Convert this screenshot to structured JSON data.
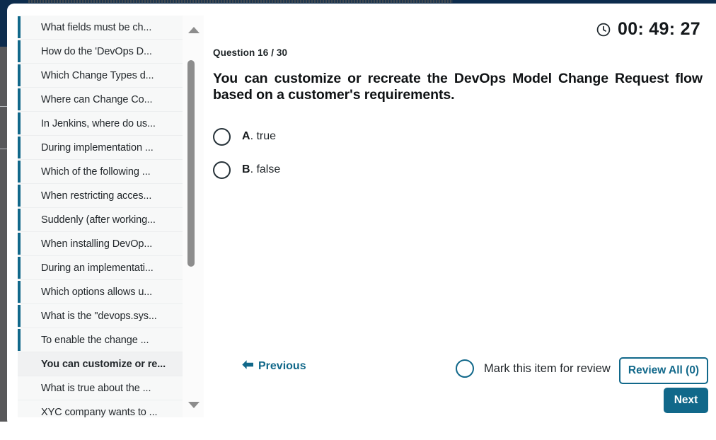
{
  "timer": {
    "icon": "clock-icon",
    "value": "00: 49: 27"
  },
  "sidebar": {
    "items": [
      {
        "label": "What fields must be ch...",
        "answered": true,
        "current": false
      },
      {
        "label": "How do the 'DevOps D...",
        "answered": true,
        "current": false
      },
      {
        "label": "Which Change Types d...",
        "answered": true,
        "current": false
      },
      {
        "label": "Where can Change Co...",
        "answered": true,
        "current": false
      },
      {
        "label": "In Jenkins, where do us...",
        "answered": true,
        "current": false
      },
      {
        "label": "During implementation ...",
        "answered": true,
        "current": false
      },
      {
        "label": "Which of the following ...",
        "answered": true,
        "current": false
      },
      {
        "label": "When restricting acces...",
        "answered": true,
        "current": false
      },
      {
        "label": "Suddenly (after working...",
        "answered": true,
        "current": false
      },
      {
        "label": "When installing DevOp...",
        "answered": true,
        "current": false
      },
      {
        "label": "During an implementati...",
        "answered": true,
        "current": false
      },
      {
        "label": "Which options allows u...",
        "answered": true,
        "current": false
      },
      {
        "label": "What is the \"devops.sys...",
        "answered": true,
        "current": false
      },
      {
        "label": "To enable the change ...",
        "answered": true,
        "current": false
      },
      {
        "label": "You can customize or re...",
        "answered": false,
        "current": true
      },
      {
        "label": "What is true about the ...",
        "answered": false,
        "current": false
      },
      {
        "label": "XYC company wants to ...",
        "answered": false,
        "current": false
      }
    ],
    "scrollbar": {
      "up_arrow": "scroll-up-arrow",
      "down_arrow": "scroll-down-arrow"
    }
  },
  "question": {
    "counter": "Question 16 / 30",
    "text": "You can customize or recreate the DevOps Model Change Request flow based on a customer's requirements.",
    "answers": [
      {
        "letter": "A",
        "suffix": ". true"
      },
      {
        "letter": "B",
        "suffix": ". false"
      }
    ]
  },
  "footer": {
    "previous_label": "Previous",
    "mark_review_label": "Mark this item for review",
    "review_all_label": "Review All (0)",
    "next_label": "Next"
  },
  "colors": {
    "teal": "#11688a",
    "navy": "#0d2c4d",
    "text": "#23282c"
  }
}
